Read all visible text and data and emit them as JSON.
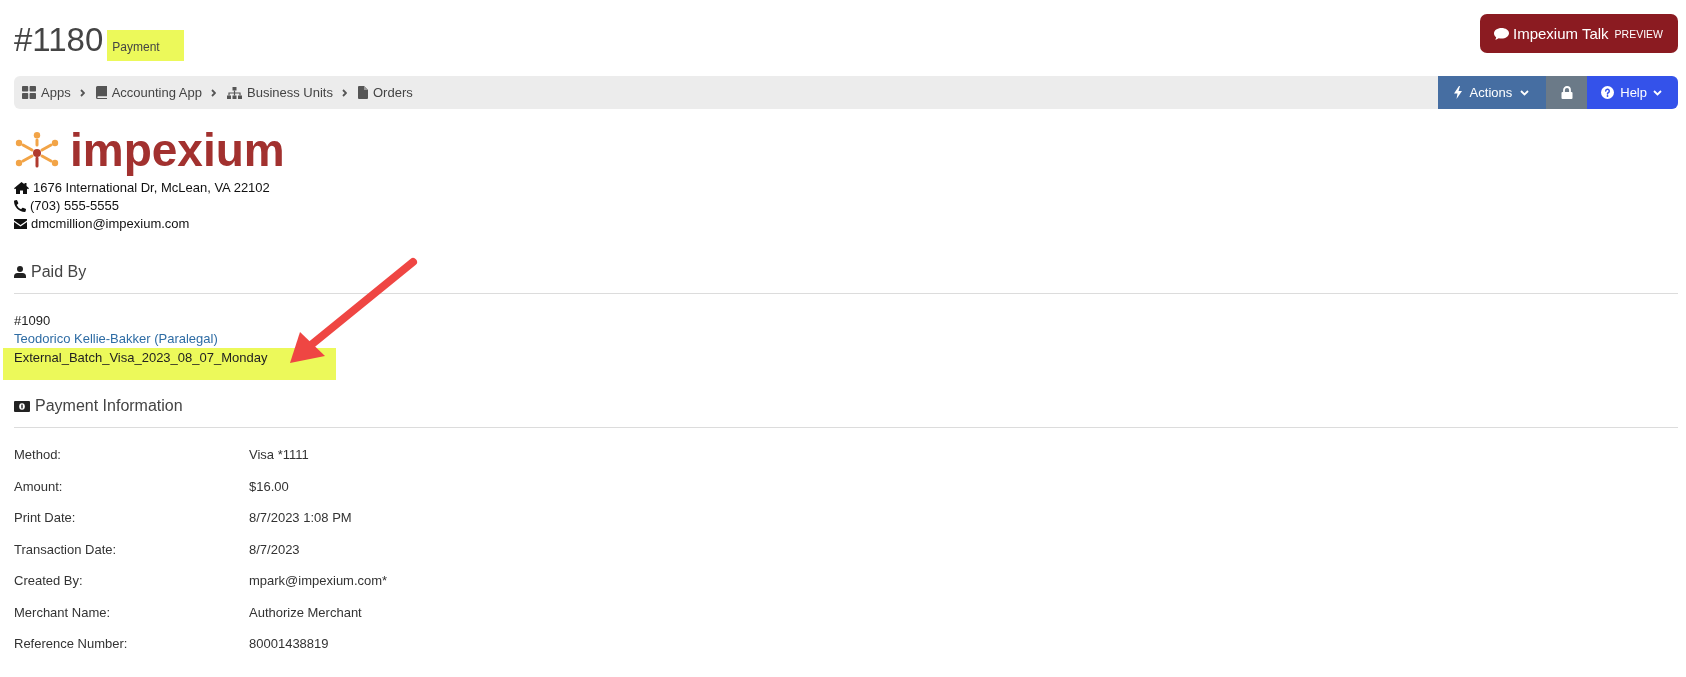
{
  "header": {
    "title": "#1180",
    "type": "Payment",
    "type_highlighted": true
  },
  "talk_button": {
    "label": "Impexium Talk",
    "tag": "PREVIEW"
  },
  "breadcrumb": [
    {
      "kind": "apps",
      "label": "Apps"
    },
    {
      "kind": "app",
      "label": "Accounting App"
    },
    {
      "kind": "units",
      "label": "Business Units"
    },
    {
      "kind": "orders",
      "label": "Orders"
    }
  ],
  "toolbar": [
    {
      "kind": "actions",
      "label": "Actions",
      "dropdown": true
    },
    {
      "kind": "lock",
      "dropdown": false
    },
    {
      "kind": "help",
      "label": "Help",
      "dropdown": true
    }
  ],
  "logo": "impexium",
  "contact": [
    {
      "kind": "address",
      "text": "1676 International Dr, McLean, VA 22102"
    },
    {
      "kind": "phone",
      "text": "(703) 555-5555"
    },
    {
      "kind": "email",
      "text": "dmcmillion@impexium.com"
    }
  ],
  "paid_by": {
    "heading": "Paid By",
    "lines": [
      {
        "kind": "number",
        "text": "#1090",
        "highlighted": false
      },
      {
        "kind": "link",
        "text": "Teodorico Kellie-Bakker (Paralegal)",
        "highlighted": false
      },
      {
        "kind": "batch",
        "text": "External_Batch_Visa_2023_08_07_Monday",
        "highlighted": true
      }
    ]
  },
  "payment_information": {
    "heading": "Payment Information",
    "fields": [
      {
        "label": "Method:",
        "value": "Visa *1111"
      },
      {
        "label": "Amount:",
        "value": "$16.00"
      },
      {
        "label": "Print Date:",
        "value": "8/7/2023 1:08 PM"
      },
      {
        "label": "Transaction Date:",
        "value": "8/7/2023"
      },
      {
        "label": "Created By:",
        "value": "mpark@impexium.com*"
      },
      {
        "label": "Merchant Name:",
        "value": "Authorize Merchant"
      },
      {
        "label": "Reference Number:",
        "value": "80001438819"
      }
    ]
  }
}
